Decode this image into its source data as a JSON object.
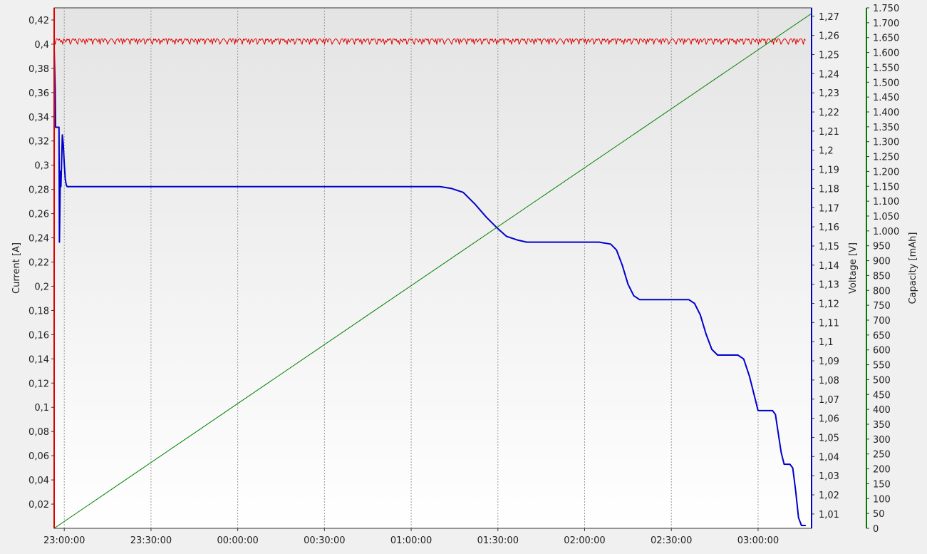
{
  "window": {
    "background": "#f0f0f0"
  },
  "chart_data": {
    "type": "line",
    "grid": {
      "vertical": true,
      "horizontal": false,
      "style": "dotted"
    },
    "x_axis": {
      "label": "",
      "range": [
        "22:56:30",
        "03:18:30"
      ],
      "ticks": [
        "23:00:00",
        "23:30:00",
        "00:00:00",
        "00:30:00",
        "01:00:00",
        "01:30:00",
        "02:00:00",
        "02:30:00",
        "03:00:00"
      ]
    },
    "y_axes": {
      "current": {
        "label": "Current [A]",
        "color": "#e00000",
        "range": [
          0,
          0.43
        ],
        "ticks": [
          "0,02",
          "0,04",
          "0,06",
          "0,08",
          "0,1",
          "0,12",
          "0,14",
          "0,16",
          "0,18",
          "0,2",
          "0,22",
          "0,24",
          "0,26",
          "0,28",
          "0,3",
          "0,32",
          "0,34",
          "0,36",
          "0,38",
          "0,4",
          "0,42"
        ]
      },
      "voltage": {
        "label": "Voltage [V]",
        "color": "#0000cc",
        "range": [
          1.0025,
          1.2744
        ],
        "ticks": [
          "1,01",
          "1,02",
          "1,03",
          "1,04",
          "1,05",
          "1,06",
          "1,07",
          "1,08",
          "1,09",
          "1,1",
          "1,11",
          "1,12",
          "1,13",
          "1,14",
          "1,15",
          "1,16",
          "1,17",
          "1,18",
          "1,19",
          "1,2",
          "1,21",
          "1,22",
          "1,23",
          "1,24",
          "1,25",
          "1,26",
          "1,27"
        ]
      },
      "capacity": {
        "label": "Capacity [mAh]",
        "color": "#008000",
        "range": [
          0,
          1750
        ],
        "ticks": [
          "0",
          "50",
          "100",
          "150",
          "200",
          "250",
          "300",
          "350",
          "400",
          "450",
          "500",
          "550",
          "600",
          "650",
          "700",
          "750",
          "800",
          "850",
          "900",
          "950",
          "1.000",
          "1.050",
          "1.100",
          "1.150",
          "1.200",
          "1.250",
          "1.300",
          "1.350",
          "1.400",
          "1.450",
          "1.500",
          "1.550",
          "1.600",
          "1.650",
          "1.700",
          "1.750"
        ]
      }
    },
    "series": [
      {
        "axis": "current",
        "color": "#e00000",
        "style": "noisy",
        "points": [
          [
            "22:56:30",
            0.404
          ],
          [
            "03:16:30",
            0.404
          ]
        ]
      },
      {
        "axis": "voltage",
        "color": "#0000cc",
        "style": "step",
        "points": [
          [
            "22:56:30",
            1.253
          ],
          [
            "22:56:50",
            1.232
          ],
          [
            "22:57:00",
            1.212
          ],
          [
            "22:58:10",
            1.212
          ],
          [
            "22:58:20",
            1.152
          ],
          [
            "22:58:40",
            1.189
          ],
          [
            "22:58:50",
            1.181
          ],
          [
            "22:59:00",
            1.189
          ],
          [
            "22:59:20",
            1.208
          ],
          [
            "22:59:40",
            1.203
          ],
          [
            "23:00:00",
            1.193
          ],
          [
            "23:00:20",
            1.185
          ],
          [
            "23:00:40",
            1.182
          ],
          [
            "23:01:00",
            1.181
          ],
          [
            "23:02:00",
            1.181
          ],
          [
            "01:00:00",
            1.181
          ],
          [
            "01:10:00",
            1.181
          ],
          [
            "01:14:00",
            1.18
          ],
          [
            "01:18:00",
            1.178
          ],
          [
            "01:22:00",
            1.172
          ],
          [
            "01:26:00",
            1.165
          ],
          [
            "01:30:00",
            1.159
          ],
          [
            "01:33:00",
            1.155
          ],
          [
            "01:37:00",
            1.153
          ],
          [
            "01:40:00",
            1.152
          ],
          [
            "02:05:00",
            1.152
          ],
          [
            "02:09:00",
            1.151
          ],
          [
            "02:11:00",
            1.148
          ],
          [
            "02:13:00",
            1.14
          ],
          [
            "02:15:00",
            1.13
          ],
          [
            "02:17:00",
            1.124
          ],
          [
            "02:19:00",
            1.122
          ],
          [
            "02:22:00",
            1.122
          ],
          [
            "02:36:00",
            1.122
          ],
          [
            "02:38:00",
            1.12
          ],
          [
            "02:40:00",
            1.114
          ],
          [
            "02:42:00",
            1.104
          ],
          [
            "02:44:00",
            1.096
          ],
          [
            "02:46:00",
            1.093
          ],
          [
            "02:53:00",
            1.093
          ],
          [
            "02:55:00",
            1.091
          ],
          [
            "02:57:00",
            1.082
          ],
          [
            "02:59:00",
            1.07
          ],
          [
            "03:00:00",
            1.064
          ],
          [
            "03:05:00",
            1.064
          ],
          [
            "03:06:00",
            1.062
          ],
          [
            "03:07:00",
            1.052
          ],
          [
            "03:08:00",
            1.042
          ],
          [
            "03:09:00",
            1.036
          ],
          [
            "03:11:00",
            1.036
          ],
          [
            "03:12:00",
            1.034
          ],
          [
            "03:13:00",
            1.022
          ],
          [
            "03:14:00",
            1.008
          ],
          [
            "03:15:00",
            1.004
          ],
          [
            "03:16:30",
            1.004
          ]
        ]
      },
      {
        "axis": "capacity",
        "color": "#008000",
        "style": "line",
        "points": [
          [
            "22:56:30",
            0
          ],
          [
            "03:18:30",
            1731
          ]
        ]
      }
    ]
  }
}
